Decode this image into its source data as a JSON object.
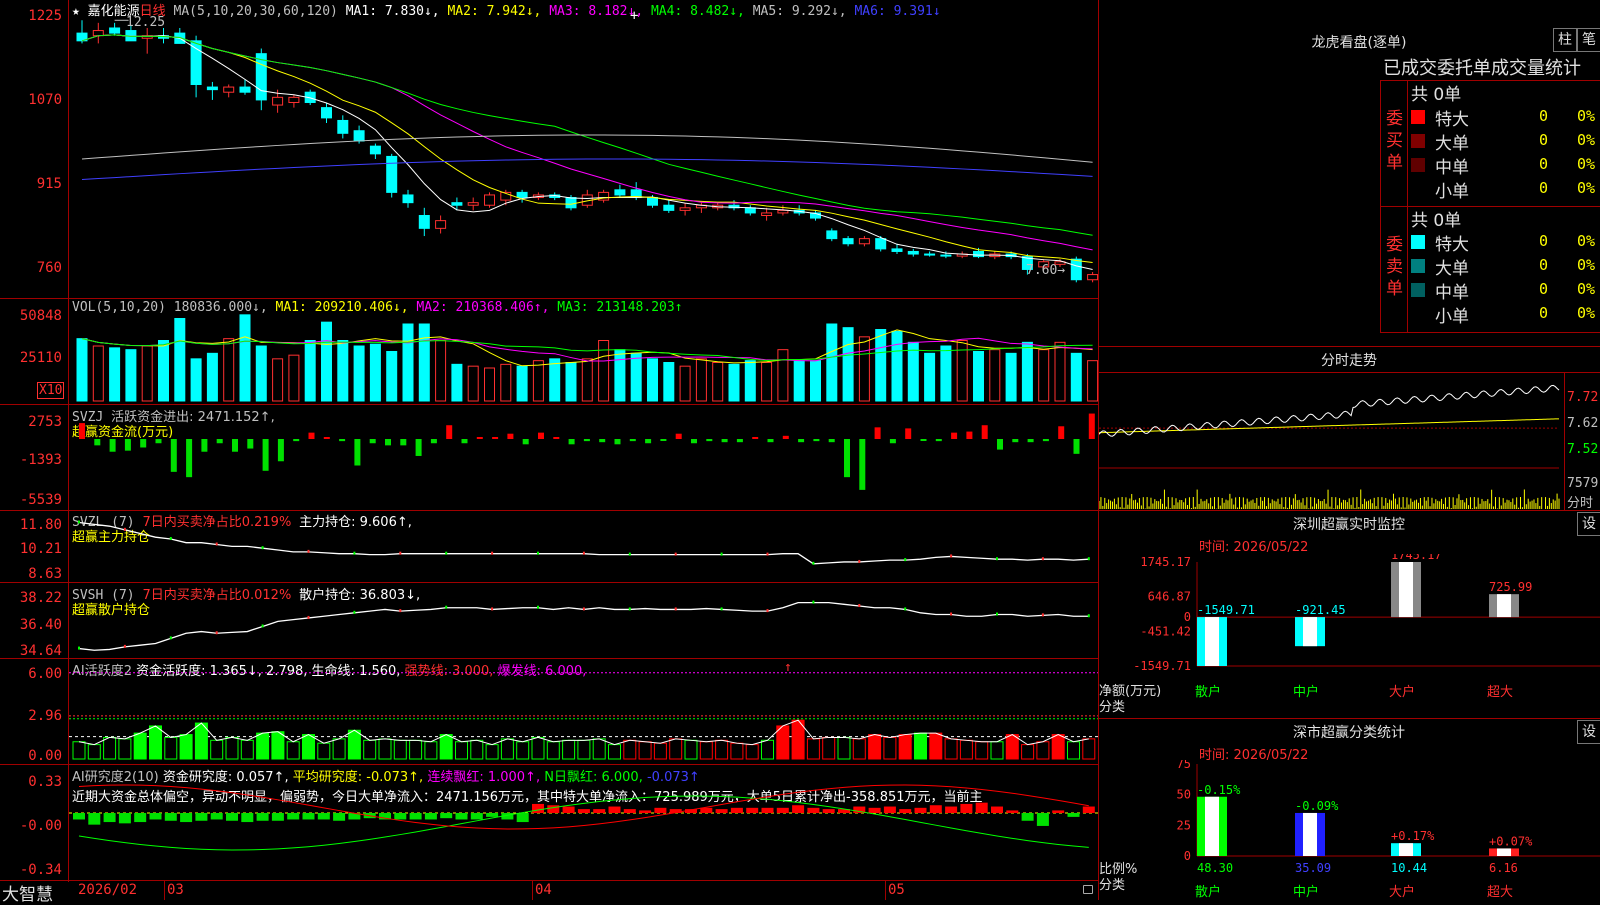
{
  "header": {
    "star": "★",
    "stock_name": "嘉化能源",
    "period": "日线",
    "ma_label": "MA(5,10,20,30,60,120)",
    "ma1": "MA1: 7.830↓,",
    "ma2": "MA2: 7.942↓,",
    "ma3": "MA3: 8.182↓,",
    "ma4": "MA4: 8.482↓,",
    "ma5": "MA5: 9.292↓,",
    "ma6": "MA6: 9.391↓",
    "plus": "+",
    "colors": {
      "ma1": "#ffffff",
      "ma2": "#ffff00",
      "ma3": "#ff00ff",
      "ma4": "#00ff00",
      "ma5": "#c0c0c0",
      "ma6": "#4040ff"
    }
  },
  "price_panel": {
    "axis_labels": [
      "1225",
      "1070",
      "915",
      "760"
    ],
    "high_label": "12.25",
    "low_label": "7.60→",
    "candles": [
      {
        "o": 12.0,
        "h": 12.25,
        "l": 11.8,
        "c": 11.85
      },
      {
        "o": 11.95,
        "h": 12.2,
        "l": 11.8,
        "c": 12.05
      },
      {
        "o": 12.1,
        "h": 12.2,
        "l": 11.95,
        "c": 12.0
      },
      {
        "o": 12.05,
        "h": 12.15,
        "l": 11.9,
        "c": 11.85
      },
      {
        "o": 11.9,
        "h": 12.1,
        "l": 11.6,
        "c": 11.95
      },
      {
        "o": 11.95,
        "h": 12.1,
        "l": 11.8,
        "c": 11.9
      },
      {
        "o": 12.0,
        "h": 12.1,
        "l": 11.8,
        "c": 11.8
      },
      {
        "o": 11.85,
        "h": 11.95,
        "l": 10.75,
        "c": 11.0
      },
      {
        "o": 10.95,
        "h": 11.05,
        "l": 10.7,
        "c": 10.9
      },
      {
        "o": 10.85,
        "h": 11.0,
        "l": 10.75,
        "c": 10.95
      },
      {
        "o": 10.95,
        "h": 11.1,
        "l": 10.8,
        "c": 10.85
      },
      {
        "o": 11.6,
        "h": 11.7,
        "l": 10.5,
        "c": 10.7
      },
      {
        "o": 10.6,
        "h": 10.9,
        "l": 10.45,
        "c": 10.75
      },
      {
        "o": 10.65,
        "h": 10.8,
        "l": 10.55,
        "c": 10.75
      },
      {
        "o": 10.85,
        "h": 10.9,
        "l": 10.6,
        "c": 10.65
      },
      {
        "o": 10.55,
        "h": 10.65,
        "l": 10.25,
        "c": 10.35
      },
      {
        "o": 10.3,
        "h": 10.4,
        "l": 9.95,
        "c": 10.05
      },
      {
        "o": 10.1,
        "h": 10.2,
        "l": 9.85,
        "c": 9.9
      },
      {
        "o": 9.8,
        "h": 9.85,
        "l": 9.55,
        "c": 9.65
      },
      {
        "o": 9.6,
        "h": 9.65,
        "l": 8.8,
        "c": 8.9
      },
      {
        "o": 8.85,
        "h": 8.95,
        "l": 8.6,
        "c": 8.7
      },
      {
        "o": 8.45,
        "h": 8.6,
        "l": 8.05,
        "c": 8.2
      },
      {
        "o": 8.2,
        "h": 8.45,
        "l": 8.1,
        "c": 8.35
      },
      {
        "o": 8.7,
        "h": 8.8,
        "l": 8.55,
        "c": 8.65
      },
      {
        "o": 8.65,
        "h": 8.8,
        "l": 8.55,
        "c": 8.7
      },
      {
        "o": 8.65,
        "h": 8.9,
        "l": 8.6,
        "c": 8.85
      },
      {
        "o": 8.75,
        "h": 8.95,
        "l": 8.65,
        "c": 8.9
      },
      {
        "o": 8.9,
        "h": 8.95,
        "l": 8.7,
        "c": 8.8
      },
      {
        "o": 8.8,
        "h": 8.9,
        "l": 8.75,
        "c": 8.85
      },
      {
        "o": 8.85,
        "h": 8.9,
        "l": 8.75,
        "c": 8.8
      },
      {
        "o": 8.8,
        "h": 8.85,
        "l": 8.55,
        "c": 8.6
      },
      {
        "o": 8.65,
        "h": 8.95,
        "l": 8.6,
        "c": 8.85
      },
      {
        "o": 8.75,
        "h": 8.95,
        "l": 8.7,
        "c": 8.9
      },
      {
        "o": 8.95,
        "h": 9.05,
        "l": 8.8,
        "c": 8.85
      },
      {
        "o": 8.95,
        "h": 9.1,
        "l": 8.75,
        "c": 8.8
      },
      {
        "o": 8.8,
        "h": 8.85,
        "l": 8.6,
        "c": 8.65
      },
      {
        "o": 8.65,
        "h": 8.75,
        "l": 8.5,
        "c": 8.55
      },
      {
        "o": 8.55,
        "h": 8.7,
        "l": 8.45,
        "c": 8.6
      },
      {
        "o": 8.6,
        "h": 8.7,
        "l": 8.5,
        "c": 8.65
      },
      {
        "o": 8.6,
        "h": 8.7,
        "l": 8.55,
        "c": 8.65
      },
      {
        "o": 8.65,
        "h": 8.75,
        "l": 8.55,
        "c": 8.6
      },
      {
        "o": 8.6,
        "h": 8.65,
        "l": 8.45,
        "c": 8.5
      },
      {
        "o": 8.45,
        "h": 8.6,
        "l": 8.35,
        "c": 8.5
      },
      {
        "o": 8.5,
        "h": 8.65,
        "l": 8.45,
        "c": 8.55
      },
      {
        "o": 8.55,
        "h": 8.65,
        "l": 8.45,
        "c": 8.5
      },
      {
        "o": 8.5,
        "h": 8.55,
        "l": 8.35,
        "c": 8.4
      },
      {
        "o": 8.15,
        "h": 8.2,
        "l": 7.95,
        "c": 8.0
      },
      {
        "o": 8.0,
        "h": 8.05,
        "l": 7.85,
        "c": 7.9
      },
      {
        "o": 7.9,
        "h": 8.05,
        "l": 7.85,
        "c": 8.0
      },
      {
        "o": 8.0,
        "h": 8.05,
        "l": 7.75,
        "c": 7.8
      },
      {
        "o": 7.8,
        "h": 7.9,
        "l": 7.7,
        "c": 7.75
      },
      {
        "o": 7.75,
        "h": 7.8,
        "l": 7.65,
        "c": 7.7
      },
      {
        "o": 7.7,
        "h": 7.75,
        "l": 7.65,
        "c": 7.68
      },
      {
        "o": 7.68,
        "h": 7.75,
        "l": 7.62,
        "c": 7.66
      },
      {
        "o": 7.66,
        "h": 7.75,
        "l": 7.62,
        "c": 7.7
      },
      {
        "o": 7.75,
        "h": 7.82,
        "l": 7.62,
        "c": 7.65
      },
      {
        "o": 7.65,
        "h": 7.75,
        "l": 7.6,
        "c": 7.7
      },
      {
        "o": 7.7,
        "h": 7.75,
        "l": 7.6,
        "c": 7.65
      },
      {
        "o": 7.65,
        "h": 7.7,
        "l": 7.3,
        "c": 7.4
      },
      {
        "o": 7.45,
        "h": 7.6,
        "l": 7.4,
        "c": 7.55
      },
      {
        "o": 7.5,
        "h": 7.6,
        "l": 7.45,
        "c": 7.55
      },
      {
        "o": 7.6,
        "h": 7.65,
        "l": 7.15,
        "c": 7.2
      },
      {
        "o": 7.2,
        "h": 7.35,
        "l": 7.15,
        "c": 7.3
      }
    ]
  },
  "vol_panel": {
    "title": "VOL(5,10,20)",
    "vol": "180836.000↓,",
    "ma1": "MA1: 209210.406↓,",
    "ma2": "MA2: 210368.406↑,",
    "ma3": "MA3: 213148.203↑",
    "axis_labels": [
      "50848",
      "25110"
    ],
    "unit": "X10",
    "values": [
      340,
      300,
      290,
      280,
      300,
      330,
      450,
      230,
      260,
      340,
      470,
      300,
      230,
      250,
      330,
      430,
      330,
      300,
      310,
      270,
      420,
      420,
      330,
      200,
      190,
      180,
      200,
      190,
      220,
      230,
      210,
      230,
      330,
      280,
      260,
      230,
      210,
      190,
      230,
      210,
      200,
      220,
      210,
      280,
      220,
      220,
      420,
      400,
      350,
      390,
      380,
      320,
      260,
      300,
      330,
      270,
      280,
      260,
      320,
      280,
      320,
      260,
      220
    ]
  },
  "svzj_panel": {
    "title": "SVZJ",
    "item1": "活跃资金进出: 2471.152↑,",
    "item2": "超赢资金流(万元)",
    "axis_labels": [
      "2753",
      "-1393",
      "-5539"
    ],
    "values": [
      1500,
      -600,
      -1200,
      -1100,
      -800,
      -400,
      -3100,
      -3600,
      -1200,
      -400,
      -1200,
      -900,
      -3000,
      -2100,
      -200,
      600,
      0,
      -200,
      -2500,
      -400,
      -600,
      -600,
      -1600,
      -400,
      1300,
      -400,
      100,
      0,
      500,
      -500,
      600,
      0,
      -500,
      -200,
      -300,
      -500,
      -200,
      -400,
      -100,
      500,
      -400,
      -200,
      -300,
      -300,
      0,
      -300,
      300,
      -300,
      -200,
      -300,
      -3600,
      -4800,
      1100,
      -400,
      1000,
      -100,
      -200,
      600,
      700,
      1300,
      -1000,
      -300,
      -300,
      -200,
      1200,
      -1400,
      2400
    ]
  },
  "svzl_panel": {
    "title": "SVZL (7)",
    "item1": "7日内买卖净占比0.219%",
    "item2": "主力持仓: 9.606↑,",
    "item3": "超赢主力持仓",
    "axis_labels": [
      "11.80",
      "10.21",
      "8.63"
    ],
    "values": [
      11.6,
      11.5,
      11.4,
      11.2,
      11.0,
      10.8,
      10.7,
      10.5,
      10.5,
      10.4,
      10.3,
      10.3,
      10.2,
      10.1,
      10.0,
      10.0,
      9.95,
      9.9,
      9.9,
      9.85,
      9.85,
      9.9,
      9.9,
      9.9,
      9.9,
      9.9,
      9.9,
      9.9,
      9.9,
      9.9,
      9.9,
      9.9,
      9.9,
      9.9,
      9.85,
      9.85,
      9.85,
      9.85,
      9.85,
      9.85,
      9.85,
      9.85,
      9.85,
      9.85,
      9.85,
      9.85,
      9.9,
      9.9,
      9.35,
      9.4,
      9.45,
      9.45,
      9.5,
      9.55,
      9.55,
      9.6,
      9.7,
      9.75,
      9.7,
      9.65,
      9.6,
      9.6,
      9.55,
      9.6,
      9.6,
      9.55,
      9.6
    ]
  },
  "svsh_panel": {
    "title": "SVSH (7)",
    "item1": "7日内买卖净占比0.012%",
    "item2": "散户持仓: 36.803↓,",
    "item3": "超赢散户持仓",
    "axis_labels": [
      "38.22",
      "36.40",
      "34.64"
    ],
    "values": [
      34.9,
      34.8,
      34.85,
      35.0,
      35.1,
      35.2,
      35.5,
      35.8,
      35.9,
      35.8,
      35.85,
      35.9,
      36.2,
      36.5,
      36.6,
      36.7,
      36.8,
      36.9,
      37.0,
      37.1,
      37.2,
      37.1,
      37.15,
      37.2,
      37.3,
      37.3,
      37.3,
      37.2,
      37.25,
      37.3,
      37.3,
      37.2,
      37.3,
      37.2,
      37.3,
      37.2,
      37.2,
      37.25,
      37.2,
      37.2,
      37.2,
      37.25,
      37.2,
      37.15,
      37.1,
      37.1,
      37.3,
      37.6,
      37.6,
      37.6,
      37.5,
      37.4,
      37.3,
      37.3,
      37.2,
      37.0,
      36.9,
      36.9,
      36.8,
      36.8,
      36.9,
      36.9,
      36.8,
      36.85,
      36.9,
      36.8,
      36.8
    ]
  },
  "ai1_panel": {
    "title": "AI活跃度2",
    "item1": "资金活跃度: 1.365↓,",
    "item2": "2.798,",
    "item3": "生命线: 1.560,",
    "item4": "强势线: 3.000,",
    "item5": "爆发线: 6.000,",
    "arrow": "↑",
    "axis_labels": [
      "6.00",
      "2.96",
      "0.00"
    ],
    "values": [
      1.2,
      1.0,
      1.5,
      1.4,
      1.8,
      2.3,
      1.5,
      1.7,
      2.5,
      1.3,
      1.5,
      1.3,
      1.8,
      1.9,
      1.2,
      1.7,
      1.1,
      1.4,
      2.0,
      1.3,
      1.4,
      1.3,
      1.3,
      1.2,
      1.7,
      1.2,
      1.3,
      1.0,
      1.4,
      1.2,
      1.5,
      1.2,
      1.3,
      1.3,
      1.4,
      1.0,
      1.3,
      1.2,
      1.1,
      1.4,
      1.3,
      1.2,
      1.3,
      1.1,
      1.0,
      1.3,
      2.3,
      2.7,
      1.4,
      1.5,
      1.5,
      1.4,
      1.7,
      1.5,
      1.7,
      1.8,
      1.8,
      1.4,
      1.3,
      1.2,
      1.2,
      1.7,
      1.0,
      1.2,
      1.7,
      1.2,
      1.4
    ]
  },
  "ai2_panel": {
    "title": "AI研究度2(10)",
    "item1": "资金研究度: 0.057↑,",
    "item2": "平均研究度: -0.073↑,",
    "item3": "连续飘红: 1.000↑,",
    "item4": "N日飘红: 6.000,",
    "item5": "-0.073↑",
    "summary": "近期大资金总体偏空，异动不明显，偏弱势，今日大单净流入：2471.156万元，其中特大单净流入：725.989万元，大单5日累计净出-358.851万元，当前主",
    "axis_labels": [
      "0.33",
      "-0.00",
      "-0.34"
    ],
    "values": [
      -0.05,
      -0.09,
      -0.07,
      -0.08,
      -0.07,
      -0.05,
      -0.06,
      -0.07,
      -0.06,
      -0.05,
      -0.06,
      -0.07,
      -0.06,
      -0.06,
      -0.05,
      -0.05,
      -0.05,
      -0.06,
      -0.05,
      -0.04,
      -0.05,
      -0.05,
      -0.05,
      -0.05,
      -0.04,
      -0.05,
      -0.05,
      -0.03,
      -0.05,
      -0.07,
      0.07,
      0.06,
      0.05,
      0.03,
      0.03,
      0.05,
      0.03,
      0.02,
      0.04,
      0.03,
      0.03,
      0.04,
      0.03,
      0.04,
      0.04,
      0.04,
      0.04,
      0.06,
      0.04,
      0.03,
      0.03,
      0.05,
      0.04,
      0.05,
      0.03,
      0.04,
      0.06,
      0.05,
      0.07,
      0.08,
      0.05,
      0.02,
      -0.06,
      -0.1,
      0.02,
      -0.03,
      0.05
    ]
  },
  "date_axis": {
    "app_name": "大智慧",
    "labels": [
      "2026/02",
      "03",
      "04",
      "05"
    ]
  },
  "right": {
    "lhb_title": "龙虎看盘(逐单)",
    "btn_zhu": "柱",
    "btn_bi": "笔",
    "lhb_subtitle": "已成交委托单成交量统计",
    "buy_label": "委买单",
    "sell_label": "委卖单",
    "buy_total": "共 0单",
    "sell_total": "共 0单",
    "rows": [
      {
        "name": "特大",
        "count": "0",
        "pct": "0%"
      },
      {
        "name": "大单",
        "count": "0",
        "pct": "0%"
      },
      {
        "name": "中单",
        "count": "0",
        "pct": "0%"
      },
      {
        "name": "小单",
        "count": "0",
        "pct": "0%"
      }
    ],
    "intraday_title": "分时走势",
    "intraday_axis": [
      "7.72",
      "7.62",
      "7.52"
    ],
    "intraday_vol_label": "7579",
    "intraday_unit": "分时",
    "sz_title": "深圳超赢实时监控",
    "sz_set": "设",
    "sz_time": "时间: 2026/05/22",
    "sz_axis": [
      "1745.17",
      "646.87",
      "0",
      "-451.42",
      "-1549.71"
    ],
    "sz_bars": [
      {
        "cat": "散户",
        "value": -1549.71,
        "label": "-1549.71"
      },
      {
        "cat": "中户",
        "value": -921.45,
        "label": "-921.45"
      },
      {
        "cat": "大户",
        "value": 1745.17,
        "label": "1745.17"
      },
      {
        "cat": "超大",
        "value": 725.99,
        "label": "725.99"
      }
    ],
    "sz_ylabel": "净额(万元)",
    "sz_xlabel": "分类",
    "cls_title": "深市超赢分类统计",
    "cls_set": "设",
    "cls_time": "时间: 2026/05/22",
    "cls_axis": [
      "75",
      "50",
      "25",
      "0"
    ],
    "cls_bars": [
      {
        "cat": "散户",
        "value": 48.3,
        "label": "48.30",
        "change": "-0.15%"
      },
      {
        "cat": "中户",
        "value": 35.09,
        "label": "35.09",
        "change": "-0.09%"
      },
      {
        "cat": "大户",
        "value": 10.44,
        "label": "10.44",
        "change": "+0.17%"
      },
      {
        "cat": "超大",
        "value": 6.16,
        "label": "6.16",
        "change": "+0.07%"
      }
    ],
    "cls_ylabel": "比例%",
    "cls_xlabel": "分类"
  },
  "chart_data": [
    {
      "type": "bar",
      "title": "深圳超赢实时监控",
      "categories": [
        "散户",
        "中户",
        "大户",
        "超大"
      ],
      "values": [
        -1549.71,
        -921.45,
        1745.17,
        725.99
      ],
      "ylabel": "净额(万元)",
      "xlabel": "分类",
      "ylim": [
        -1549.71,
        1745.17
      ]
    },
    {
      "type": "bar",
      "title": "深市超赢分类统计",
      "categories": [
        "散户",
        "中户",
        "大户",
        "超大"
      ],
      "values": [
        48.3,
        35.09,
        10.44,
        6.16
      ],
      "ylabel": "比例%",
      "xlabel": "分类",
      "ylim": [
        0,
        75
      ]
    }
  ]
}
